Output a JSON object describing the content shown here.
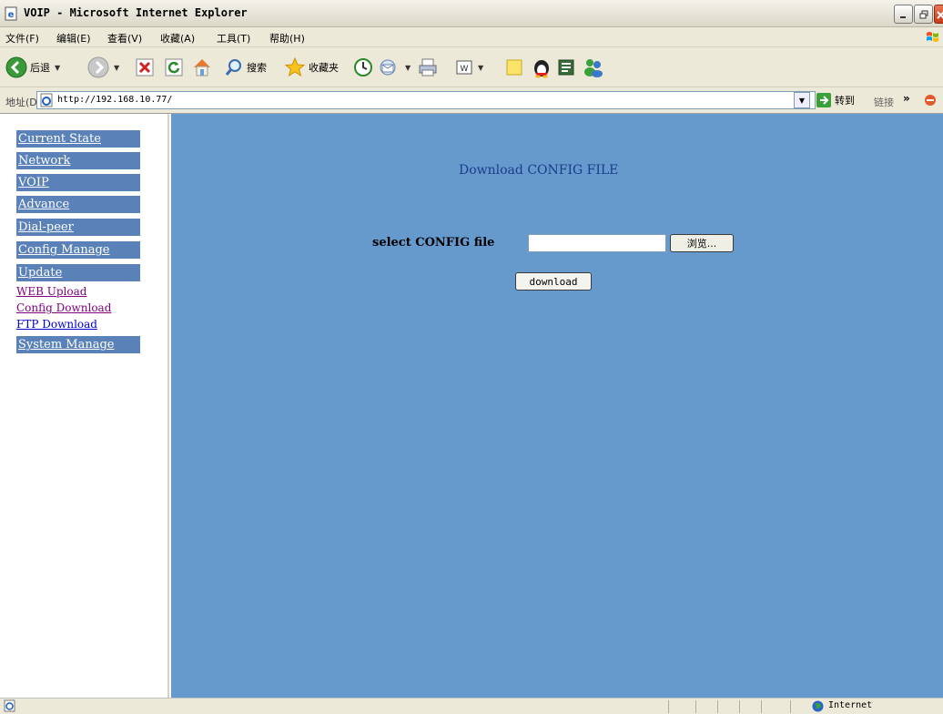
{
  "window": {
    "title": "VOIP - Microsoft Internet Explorer",
    "icon": "ie-page-icon"
  },
  "menubar": {
    "items": [
      "文件(F)",
      "编辑(E)",
      "查看(V)",
      "收藏(A)",
      "工具(T)",
      "帮助(H)"
    ]
  },
  "toolbar": {
    "back_label": "后退",
    "search_label": "搜索",
    "favorites_label": "收藏夹"
  },
  "address": {
    "label": "地址(D)",
    "url": "http://192.168.10.77/",
    "go_label": "转到",
    "links_label": "链接"
  },
  "nav": {
    "items": [
      "Current State",
      "Network",
      "VOIP",
      "Advance",
      "Dial-peer",
      "Config Manage",
      "Update"
    ],
    "sub_items": [
      "WEB Upload",
      "Config Download",
      "FTP Download"
    ],
    "after_items": [
      "System Manage"
    ]
  },
  "main": {
    "heading": "Download CONFIG FILE",
    "file_label": "select CONFIG file",
    "file_value": "",
    "browse_label": "浏览...",
    "download_label": "download"
  },
  "status": {
    "zone": "Internet"
  },
  "colors": {
    "main_bg": "#6699cc",
    "nav_bg": "#5a82b8",
    "heading": "#1a3c8c"
  }
}
